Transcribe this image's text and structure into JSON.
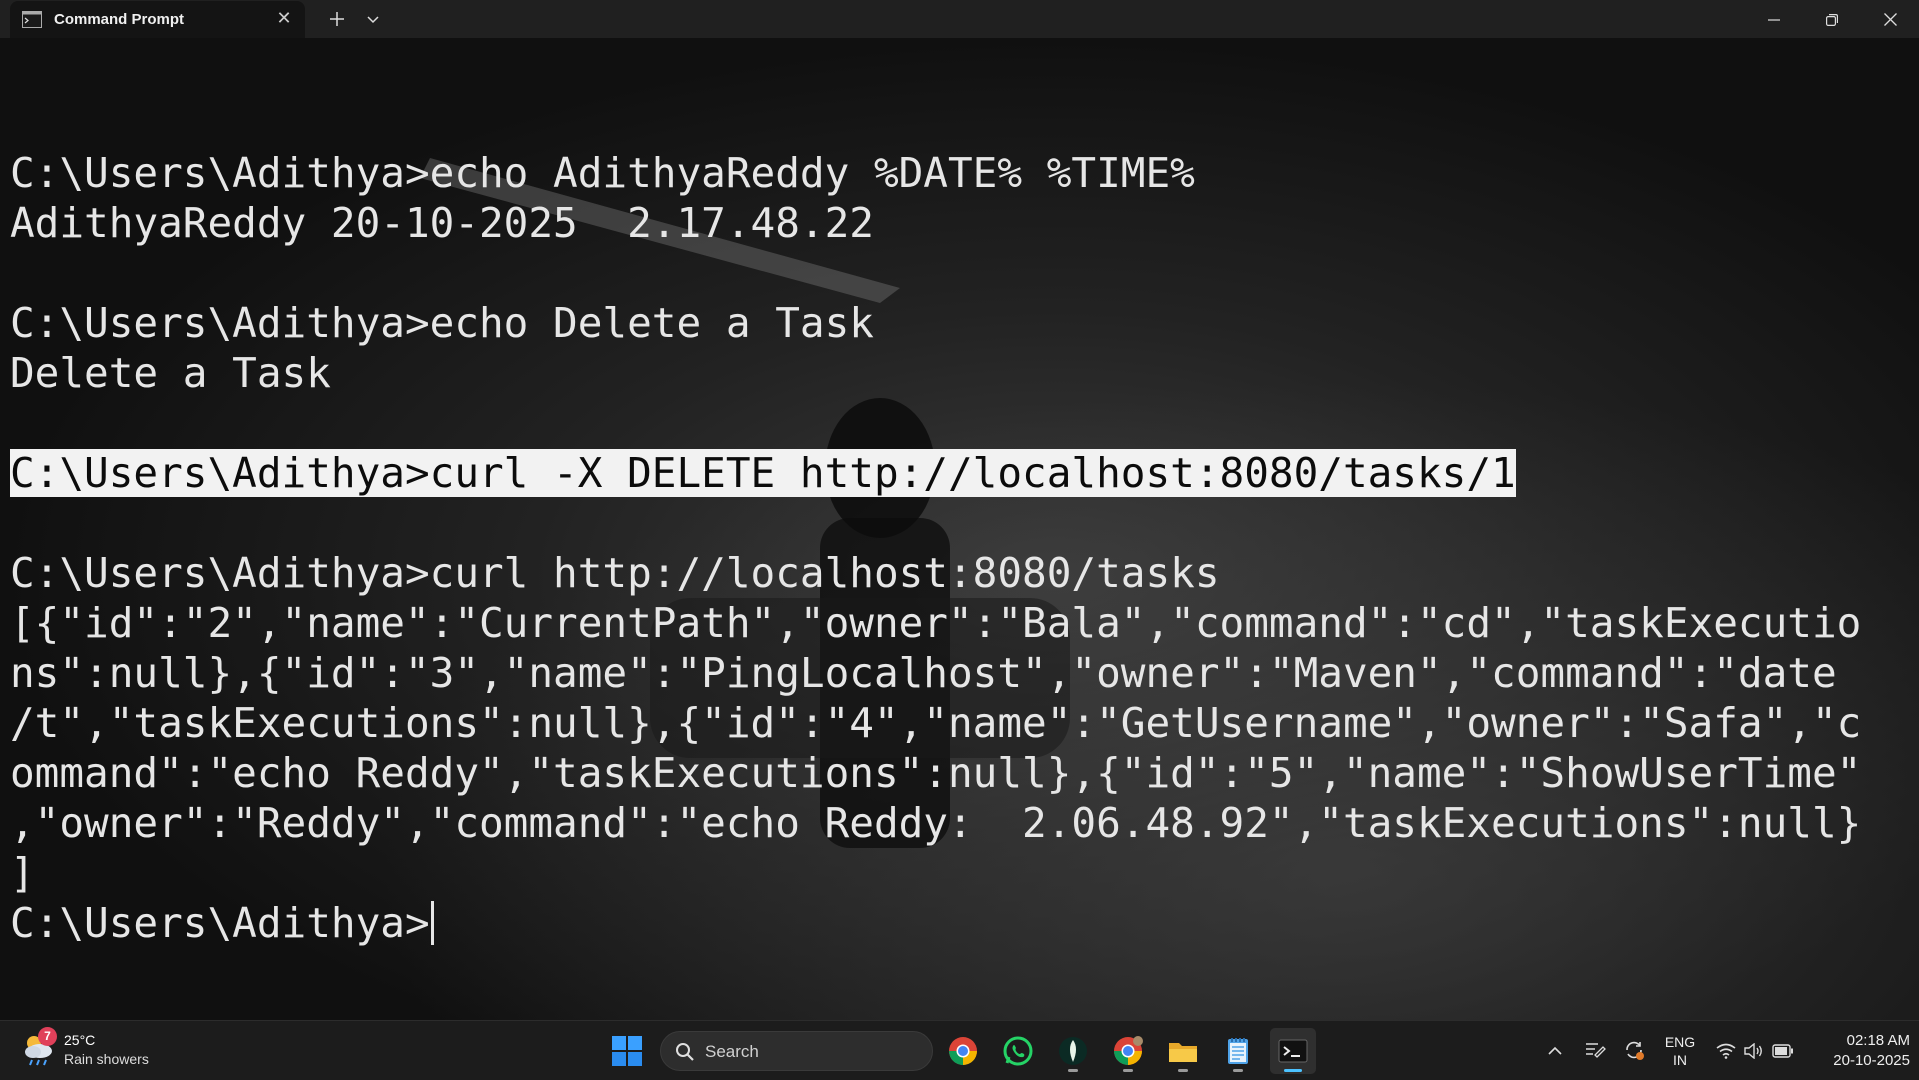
{
  "window": {
    "tab_title": "Command Prompt",
    "tab_icon": "cmd-icon"
  },
  "terminal": {
    "lines": [
      "",
      "C:\\Users\\Adithya>echo AdithyaReddy %DATE% %TIME%",
      "AdithyaReddy 20-10-2025  2.17.48.22",
      "",
      "C:\\Users\\Adithya>echo Delete a Task",
      "Delete a Task",
      "",
      "C:\\Users\\Adithya>curl -X DELETE http://localhost:8080/tasks/1",
      "",
      "C:\\Users\\Adithya>curl http://localhost:8080/tasks",
      "[{\"id\":\"2\",\"name\":\"CurrentPath\",\"owner\":\"Bala\",\"command\":\"cd\",\"taskExecutio",
      "ns\":null},{\"id\":\"3\",\"name\":\"PingLocalhost\",\"owner\":\"Maven\",\"command\":\"date",
      "/t\",\"taskExecutions\":null},{\"id\":\"4\",\"name\":\"GetUsername\",\"owner\":\"Safa\",\"c",
      "ommand\":\"echo Reddy\",\"taskExecutions\":null},{\"id\":\"5\",\"name\":\"ShowUserTime\"",
      ",\"owner\":\"Reddy\",\"command\":\"echo Reddy:  2.06.48.92\",\"taskExecutions\":null}",
      "]",
      "C:\\Users\\Adithya>"
    ],
    "highlighted_line_index": 7,
    "cursor_line_index": 16
  },
  "taskbar": {
    "weather": {
      "temp": "25°C",
      "condition": "Rain showers",
      "badge": "7"
    },
    "search_placeholder": "Search",
    "apps": [
      {
        "name": "start-icon"
      },
      {
        "name": "chrome-icon"
      },
      {
        "name": "whatsapp-icon"
      },
      {
        "name": "mongodb-compass-icon"
      },
      {
        "name": "chrome-profile-icon"
      },
      {
        "name": "file-explorer-icon"
      },
      {
        "name": "notepad-icon"
      },
      {
        "name": "terminal-icon"
      }
    ],
    "language": {
      "line1": "ENG",
      "line2": "IN"
    },
    "clock": {
      "time": "02:18 AM",
      "date": "20-10-2025"
    }
  }
}
